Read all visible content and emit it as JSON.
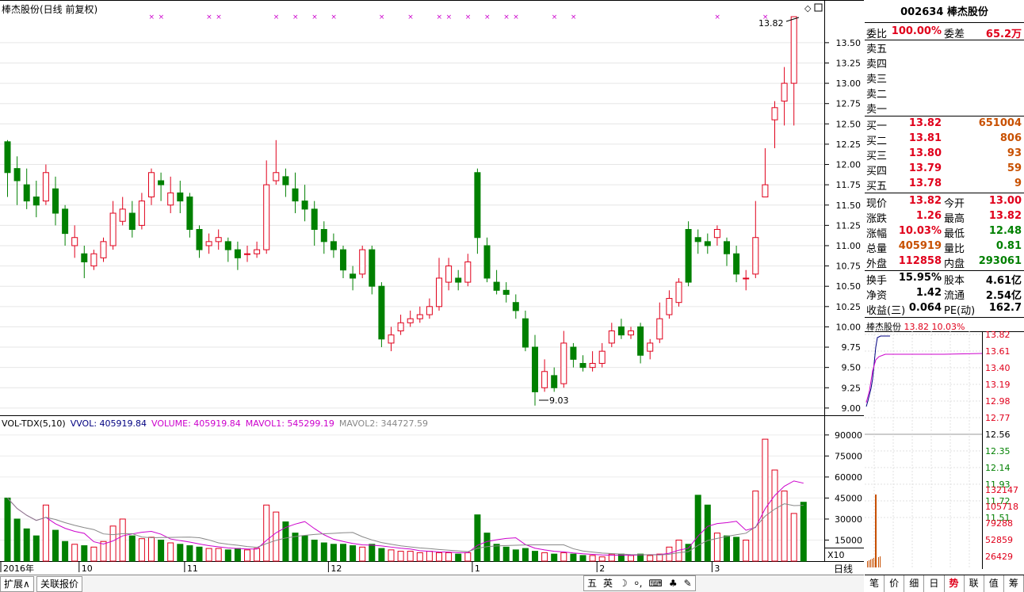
{
  "window": {
    "title": "棒杰股份(日线 前复权)"
  },
  "candle_panel": {
    "y_ticks": [
      "13.50",
      "13.25",
      "13.00",
      "12.75",
      "12.50",
      "12.25",
      "12.00",
      "11.75",
      "11.50",
      "11.25",
      "11.00",
      "10.75",
      "10.50",
      "10.25",
      "10.00",
      "9.75",
      "9.50",
      "9.25",
      "9.00"
    ],
    "high_label": "13.82",
    "low_label": "9.03"
  },
  "volume_panel": {
    "legend_name": "VOL-TDX(5,10)",
    "legend_vvol": "VVOL: 405919.84",
    "legend_volume": "VOLUME: 405919.84",
    "legend_mavol1": "MAVOL1: 545299.19",
    "legend_mavol2": "MAVOL2: 344727.59",
    "y_ticks": [
      "90000",
      "75000",
      "60000",
      "45000",
      "30000",
      "15000"
    ],
    "unit_label": "X10"
  },
  "time_axis": {
    "labels": [
      "2016年",
      "10",
      "11",
      "12",
      "1",
      "2",
      "3"
    ],
    "period_label": "日线"
  },
  "bottom_bar": {
    "expand_button": "扩展∧",
    "related_button": "关联报价",
    "ime": [
      "五",
      "英",
      "☽",
      "⸰,",
      "⌨",
      "♣",
      "✎"
    ]
  },
  "quote": {
    "header": "002634 棒杰股份",
    "weibi_label": "委比",
    "weibi_value": "100.00%",
    "weicha_label": "委差",
    "weicha_value": "65.2万",
    "sell": [
      {
        "label": "卖五"
      },
      {
        "label": "卖四"
      },
      {
        "label": "卖三"
      },
      {
        "label": "卖二"
      },
      {
        "label": "卖一"
      }
    ],
    "buy": [
      {
        "label": "买一",
        "price": "13.82",
        "vol": "651004"
      },
      {
        "label": "买二",
        "price": "13.81",
        "vol": "806"
      },
      {
        "label": "买三",
        "price": "13.80",
        "vol": "93"
      },
      {
        "label": "买四",
        "price": "13.79",
        "vol": "59"
      },
      {
        "label": "买五",
        "price": "13.78",
        "vol": "9"
      }
    ],
    "stats": [
      {
        "l1": "现价",
        "v1": "13.82",
        "l2": "今开",
        "v2": "13.00"
      },
      {
        "l1": "涨跌",
        "v1": "1.26",
        "l2": "最高",
        "v2": "13.82"
      },
      {
        "l1": "涨幅",
        "v1": "10.03%",
        "l2": "最低",
        "v2": "12.48"
      },
      {
        "l1": "总量",
        "v1": "405919",
        "l2": "量比",
        "v2": "0.81"
      },
      {
        "l1": "外盘",
        "v1": "112858",
        "l2": "内盘",
        "v2": "293061"
      }
    ],
    "stats2": [
      {
        "l1": "换手",
        "v1": "15.95%",
        "l2": "股本",
        "v2": "4.61亿"
      },
      {
        "l1": "净资",
        "v1": "1.42",
        "l2": "流通",
        "v2": "2.54亿"
      },
      {
        "l1": "收益(三)",
        "v1": "0.064",
        "l2": "PE(动)",
        "v2": "162.7"
      }
    ]
  },
  "mini_chart": {
    "name": "棒杰股份",
    "price": "13.82",
    "pct": "10.03%",
    "price_ticks": [
      "13.82",
      "13.61",
      "13.40",
      "13.19",
      "12.98",
      "12.77",
      "12.56",
      "12.35",
      "12.14",
      "11.93",
      "11.72",
      "11.51"
    ],
    "vol_ticks": [
      "132147",
      "105718",
      "79288",
      "52859",
      "26429"
    ]
  },
  "tabs": [
    "笔",
    "价",
    "细",
    "日",
    "势",
    "联",
    "值",
    "筹"
  ],
  "active_tab": "势",
  "colors": {
    "up": "#e0001b",
    "down": "#008000",
    "ma1": "#cc00cc",
    "ma2": "#888888",
    "marker": "#cc00cc"
  },
  "chart_data": {
    "type": "candlestick",
    "title": "棒杰股份(日线 前复权)",
    "ylim": [
      9.0,
      13.82
    ],
    "candles": [
      [
        12.28,
        11.9,
        12.3,
        11.6
      ],
      [
        11.95,
        11.8,
        12.1,
        11.5
      ],
      [
        11.75,
        11.55,
        11.95,
        11.45
      ],
      [
        11.6,
        11.5,
        11.8,
        11.35
      ],
      [
        11.55,
        11.9,
        12.0,
        11.5
      ],
      [
        11.7,
        11.4,
        11.85,
        11.25
      ],
      [
        11.45,
        11.15,
        11.5,
        11.0
      ],
      [
        11.0,
        11.1,
        11.25,
        10.85
      ],
      [
        10.9,
        10.8,
        11.0,
        10.6
      ],
      [
        10.75,
        10.9,
        10.95,
        10.7
      ],
      [
        10.85,
        11.05,
        11.1,
        10.8
      ],
      [
        11.0,
        11.4,
        11.55,
        10.95
      ],
      [
        11.3,
        11.45,
        11.6,
        11.25
      ],
      [
        11.4,
        11.2,
        11.55,
        11.1
      ],
      [
        11.25,
        11.55,
        11.65,
        11.2
      ],
      [
        11.6,
        11.9,
        11.95,
        11.5
      ],
      [
        11.8,
        11.75,
        11.9,
        11.55
      ],
      [
        11.5,
        11.65,
        11.85,
        11.4
      ],
      [
        11.65,
        11.55,
        11.8,
        11.4
      ],
      [
        11.6,
        11.2,
        11.65,
        11.1
      ],
      [
        11.2,
        10.95,
        11.25,
        10.85
      ],
      [
        11.0,
        11.05,
        11.15,
        10.9
      ],
      [
        11.05,
        11.1,
        11.2,
        10.95
      ],
      [
        11.05,
        10.95,
        11.1,
        10.8
      ],
      [
        10.95,
        10.85,
        11.05,
        10.7
      ],
      [
        10.9,
        10.9,
        11.0,
        10.8
      ],
      [
        10.9,
        10.95,
        11.05,
        10.85
      ],
      [
        10.95,
        11.75,
        12.05,
        10.9
      ],
      [
        11.8,
        11.9,
        12.3,
        11.75
      ],
      [
        11.85,
        11.75,
        11.95,
        11.6
      ],
      [
        11.7,
        11.55,
        11.9,
        11.4
      ],
      [
        11.55,
        11.45,
        11.75,
        11.3
      ],
      [
        11.45,
        11.2,
        11.55,
        11.0
      ],
      [
        11.2,
        11.05,
        11.3,
        10.9
      ],
      [
        11.05,
        10.95,
        11.15,
        10.85
      ],
      [
        10.95,
        10.7,
        11.0,
        10.6
      ],
      [
        10.65,
        10.6,
        10.75,
        10.45
      ],
      [
        10.65,
        10.95,
        11.0,
        10.6
      ],
      [
        10.95,
        10.5,
        11.0,
        10.4
      ],
      [
        10.5,
        9.85,
        10.55,
        9.75
      ],
      [
        9.8,
        9.9,
        10.0,
        9.7
      ],
      [
        9.95,
        10.05,
        10.15,
        9.9
      ],
      [
        10.05,
        10.1,
        10.2,
        10.0
      ],
      [
        10.1,
        10.15,
        10.25,
        10.05
      ],
      [
        10.15,
        10.25,
        10.35,
        10.1
      ],
      [
        10.25,
        10.6,
        10.85,
        10.2
      ],
      [
        10.55,
        10.75,
        10.85,
        10.45
      ],
      [
        10.6,
        10.55,
        10.7,
        10.45
      ],
      [
        10.55,
        10.8,
        10.9,
        10.5
      ],
      [
        11.9,
        11.1,
        11.95,
        10.9
      ],
      [
        11.0,
        10.6,
        11.1,
        10.55
      ],
      [
        10.55,
        10.45,
        10.7,
        10.4
      ],
      [
        10.45,
        10.4,
        10.55,
        10.3
      ],
      [
        10.3,
        10.2,
        10.4,
        10.1
      ],
      [
        10.1,
        9.75,
        10.2,
        9.7
      ],
      [
        9.75,
        9.2,
        9.9,
        9.03
      ],
      [
        9.25,
        9.45,
        9.6,
        9.2
      ],
      [
        9.4,
        9.25,
        9.5,
        9.2
      ],
      [
        9.3,
        9.8,
        9.95,
        9.25
      ],
      [
        9.75,
        9.6,
        9.8,
        9.5
      ],
      [
        9.55,
        9.5,
        9.65,
        9.45
      ],
      [
        9.5,
        9.55,
        9.7,
        9.45
      ],
      [
        9.55,
        9.7,
        9.8,
        9.5
      ],
      [
        9.8,
        9.95,
        10.05,
        9.75
      ],
      [
        10.0,
        9.9,
        10.1,
        9.85
      ],
      [
        9.9,
        9.95,
        10.0,
        9.85
      ],
      [
        10.0,
        9.65,
        10.05,
        9.55
      ],
      [
        9.7,
        9.8,
        9.85,
        9.6
      ],
      [
        9.85,
        10.1,
        10.3,
        9.8
      ],
      [
        10.15,
        10.35,
        10.45,
        10.1
      ],
      [
        10.3,
        10.55,
        10.6,
        10.25
      ],
      [
        11.2,
        10.55,
        11.3,
        10.5
      ],
      [
        11.1,
        11.05,
        11.2,
        10.9
      ],
      [
        11.05,
        11.0,
        11.15,
        10.9
      ],
      [
        11.1,
        11.2,
        11.25,
        11.0
      ],
      [
        11.05,
        10.9,
        11.1,
        10.75
      ],
      [
        10.9,
        10.65,
        11.0,
        10.55
      ],
      [
        10.6,
        10.6,
        10.7,
        10.45
      ],
      [
        10.65,
        11.1,
        11.55,
        10.6
      ],
      [
        11.6,
        11.75,
        12.2,
        11.6
      ],
      [
        12.55,
        12.7,
        12.78,
        12.2
      ],
      [
        12.78,
        13.0,
        13.2,
        12.48
      ],
      [
        13.0,
        13.82,
        13.82,
        12.48
      ]
    ],
    "volume": [
      45000,
      30000,
      23000,
      18000,
      40000,
      22000,
      14000,
      12000,
      11000,
      10000,
      14000,
      25000,
      30000,
      18000,
      16000,
      17000,
      15000,
      13000,
      12000,
      11000,
      10000,
      9000,
      9000,
      8000,
      9000,
      8000,
      9000,
      40000,
      35000,
      28000,
      20000,
      18000,
      15000,
      13000,
      12000,
      12000,
      11000,
      10000,
      12000,
      9000,
      8000,
      7000,
      7000,
      6000,
      7000,
      6000,
      6000,
      5000,
      6000,
      33000,
      20000,
      12000,
      10000,
      8000,
      9000,
      7000,
      6000,
      5000,
      6000,
      5000,
      4000,
      4000,
      3000,
      5000,
      5000,
      4000,
      5000,
      4000,
      5000,
      10000,
      15000,
      12000,
      47000,
      40000,
      20000,
      18000,
      17000,
      15000,
      50000,
      87000,
      65000,
      50000,
      34000,
      42000
    ]
  }
}
